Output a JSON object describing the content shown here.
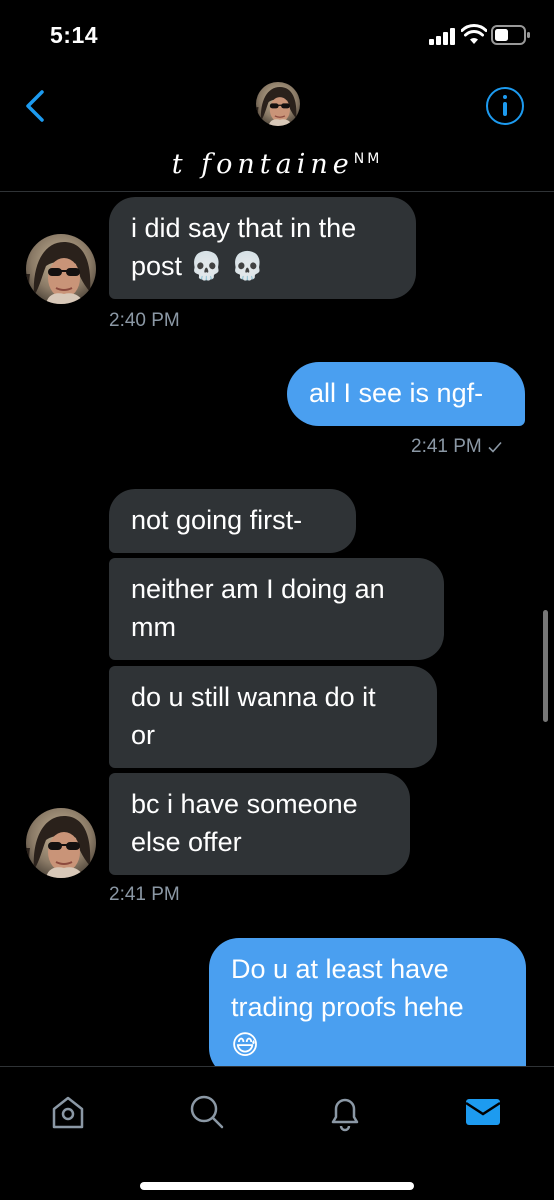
{
  "status_bar": {
    "time": "5:14"
  },
  "header": {
    "name": "t fontaine",
    "name_suffix": "NM"
  },
  "messages": [
    {
      "direction": "incoming",
      "text": "i did say that in the\npost 💀 💀"
    },
    {
      "timestamp": "2:40 PM"
    },
    {
      "direction": "outgoing",
      "text": "all I see is ngf-"
    },
    {
      "timestamp": "2:41 PM"
    },
    {
      "direction": "incoming",
      "text": "not going first-"
    },
    {
      "direction": "incoming",
      "text": "neither am I doing an\nmm"
    },
    {
      "direction": "incoming",
      "text": "do u still wanna do it\nor"
    },
    {
      "direction": "incoming",
      "text": "bc i have someone\nelse offer"
    },
    {
      "timestamp": "2:41 PM"
    },
    {
      "direction": "outgoing",
      "text": "Do u at least have\ntrading proofs hehe\n😅"
    }
  ],
  "icons": {
    "back": "chevron-left-icon",
    "info": "info-icon",
    "read_receipt": "checkmark-icon",
    "tabs": [
      "home-icon",
      "search-icon",
      "bell-icon",
      "mail-icon"
    ]
  },
  "colors": {
    "accent": "#1d9bf0",
    "outgoing_bubble": "#4a9ff0",
    "incoming_bubble": "#2f3336",
    "background": "#000000",
    "timestamp": "#8b98a5"
  },
  "active_tab": "messages"
}
